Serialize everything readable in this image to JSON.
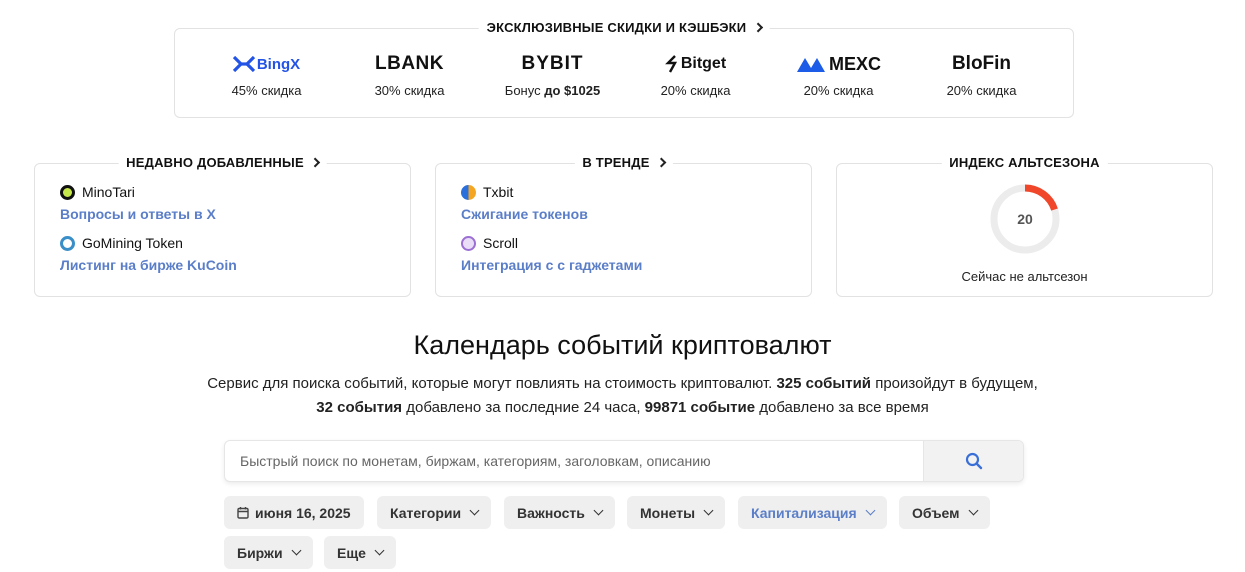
{
  "deals": {
    "title": "ЭКСКЛЮЗИВНЫЕ СКИДКИ И КЭШБЭКИ",
    "items": [
      {
        "logo": "BingX",
        "prefix": "",
        "text": "45% скидка"
      },
      {
        "logo": "LBANK",
        "prefix": "",
        "text": "30% скидка"
      },
      {
        "logo": "BYBIT",
        "prefix": "Бонус",
        "text": "до $1025"
      },
      {
        "logo": "Bitget",
        "prefix": "",
        "text": "20% скидка"
      },
      {
        "logo": "MEXC",
        "prefix": "",
        "text": "20% скидка"
      },
      {
        "logo": "BloFin",
        "prefix": "",
        "text": "20% скидка"
      }
    ]
  },
  "recent": {
    "title": "НЕДАВНО ДОБАВЛЕННЫЕ",
    "items": [
      {
        "coin": "MinoTari",
        "event": "Вопросы и ответы в X",
        "icon": "minotari-icon"
      },
      {
        "coin": "GoMining Token",
        "event": "Листинг на бирже KuCoin",
        "icon": "gomining-icon"
      }
    ]
  },
  "trending": {
    "title": "В ТРЕНДЕ",
    "items": [
      {
        "coin": "Txbit",
        "event": "Сжигание токенов",
        "icon": "txbit-icon"
      },
      {
        "coin": "Scroll",
        "event": "Интеграция с с гаджетами",
        "icon": "scroll-icon"
      }
    ]
  },
  "altseason": {
    "title": "ИНДЕКС АЛЬТСЕЗОНА",
    "value": "20",
    "level": 20,
    "caption": "Сейчас не альтсезон",
    "color": "#f0472b"
  },
  "main": {
    "title": "Календарь событий криптовалют",
    "intro": {
      "p1": "Сервис для поиска событий, которые могут повлиять на стоимость криптовалют.",
      "n1": "325 событий",
      "p2": "произойдут в будущем,",
      "n2": "32 события",
      "p3": "добавлено за последние 24 часа,",
      "n3": "99871 событие",
      "p4": "добавлено за все время"
    }
  },
  "search": {
    "placeholder": "Быстрый поиск по монетам, биржам, категориям, заголовкам, описанию"
  },
  "filters": {
    "date": "июня 16, 2025",
    "categories": "Категории",
    "importance": "Важность",
    "coins": "Монеты",
    "capitalization": "Капитализация",
    "volume": "Объем",
    "exchanges": "Биржи",
    "more": "Еще"
  },
  "colors": {
    "link": "#5b7ec8",
    "accent_red": "#f0472b",
    "border": "#e2e2e2"
  }
}
